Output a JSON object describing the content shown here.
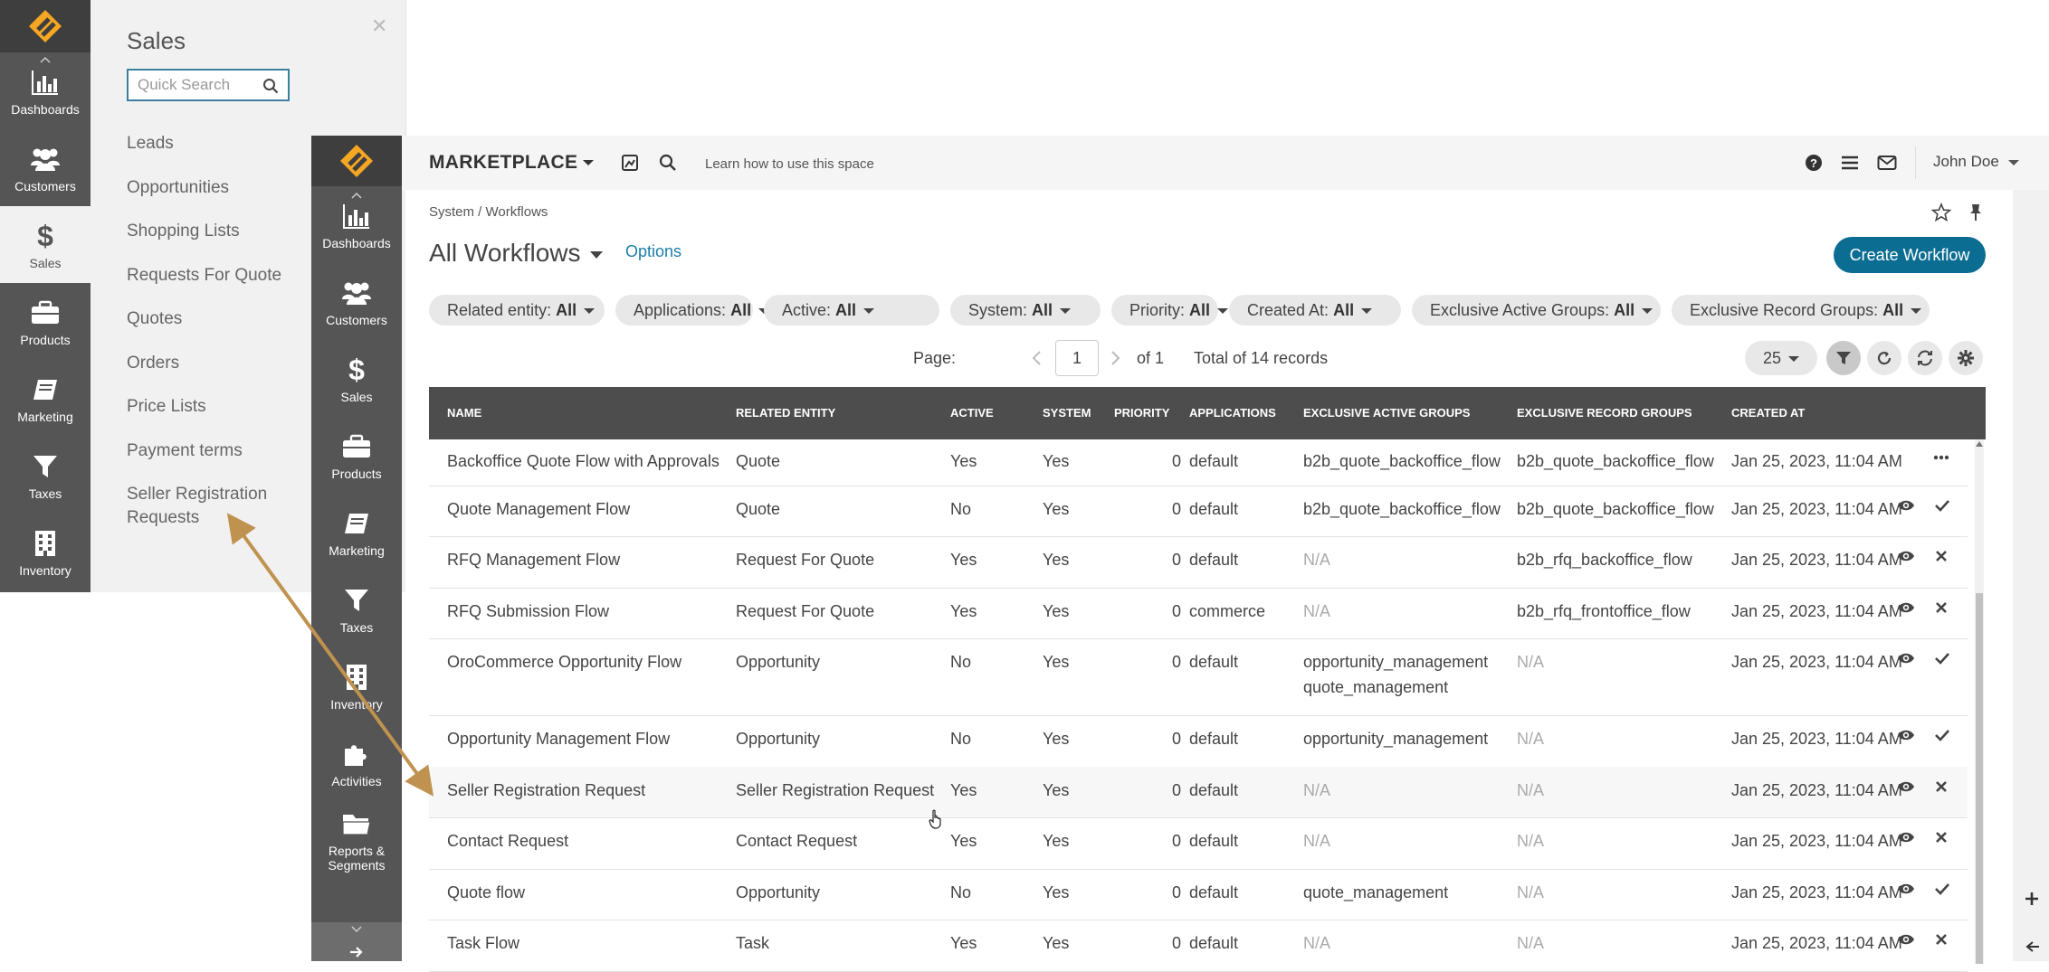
{
  "menu": {
    "section_title": "Sales",
    "search_placeholder": "Quick Search",
    "items": [
      "Leads",
      "Opportunities",
      "Shopping Lists",
      "Requests For Quote",
      "Quotes",
      "Orders",
      "Price Lists",
      "Payment terms",
      "Seller Registration Requests"
    ]
  },
  "outer_sidebar": {
    "items": [
      {
        "label": "Dashboards",
        "icon": "bar-chart-icon"
      },
      {
        "label": "Customers",
        "icon": "users-icon"
      },
      {
        "label": "Sales",
        "icon": "dollar-icon"
      },
      {
        "label": "Products",
        "icon": "briefcase-icon"
      },
      {
        "label": "Marketing",
        "icon": "book-icon"
      },
      {
        "label": "Taxes",
        "icon": "filter-icon"
      },
      {
        "label": "Inventory",
        "icon": "building-icon"
      }
    ]
  },
  "inner_sidebar": {
    "items": [
      {
        "label": "Dashboards",
        "icon": "bar-chart-icon"
      },
      {
        "label": "Customers",
        "icon": "users-icon"
      },
      {
        "label": "Sales",
        "icon": "dollar-icon"
      },
      {
        "label": "Products",
        "icon": "briefcase-icon"
      },
      {
        "label": "Marketing",
        "icon": "book-icon"
      },
      {
        "label": "Taxes",
        "icon": "filter-icon"
      },
      {
        "label": "Inventory",
        "icon": "building-icon"
      },
      {
        "label": "Activities",
        "icon": "puzzle-icon"
      },
      {
        "label": "Reports & Segments",
        "icon": "folder-icon"
      }
    ]
  },
  "topbar": {
    "brand": "MARKETPLACE",
    "learn_link": "Learn how to use this space",
    "user_name": "John Doe"
  },
  "page": {
    "breadcrumb": "System / Workflows",
    "title": "All Workflows",
    "options": "Options",
    "create_button": "Create Workflow"
  },
  "filters": [
    {
      "label": "Related entity:",
      "value": "All"
    },
    {
      "label": "Applications:",
      "value": "All"
    },
    {
      "label": "Active:",
      "value": "All"
    },
    {
      "label": "System:",
      "value": "All"
    },
    {
      "label": "Priority:",
      "value": "All"
    },
    {
      "label": "Created At:",
      "value": "All"
    },
    {
      "label": "Exclusive Active Groups:",
      "value": "All"
    },
    {
      "label": "Exclusive Record Groups:",
      "value": "All"
    }
  ],
  "pager": {
    "page_label": "Page:",
    "current_page": "1",
    "of_label": "of 1",
    "total": "Total of 14 records",
    "page_size": "25"
  },
  "grid": {
    "columns": [
      "NAME",
      "RELATED ENTITY",
      "ACTIVE",
      "SYSTEM",
      "PRIORITY",
      "APPLICATIONS",
      "EXCLUSIVE ACTIVE GROUPS",
      "EXCLUSIVE RECORD GROUPS",
      "CREATED AT"
    ],
    "rows": [
      {
        "name": "Backoffice Quote Flow with Approvals",
        "entity": "Quote",
        "active": "Yes",
        "system": "Yes",
        "priority": "0",
        "applications": "default",
        "active_groups": [
          "b2b_quote_backoffice_flow"
        ],
        "record_groups": "b2b_quote_backoffice_flow",
        "created": "Jan 25, 2023, 11:04 AM",
        "actions": [
          "more"
        ]
      },
      {
        "name": "Quote Management Flow",
        "entity": "Quote",
        "active": "No",
        "system": "Yes",
        "priority": "0",
        "applications": "default",
        "active_groups": [
          "b2b_quote_backoffice_flow"
        ],
        "record_groups": "b2b_quote_backoffice_flow",
        "created": "Jan 25, 2023, 11:04 AM",
        "actions": [
          "view",
          "activate"
        ]
      },
      {
        "name": "RFQ Management Flow",
        "entity": "Request For Quote",
        "active": "Yes",
        "system": "Yes",
        "priority": "0",
        "applications": "default",
        "active_groups": [
          "N/A"
        ],
        "record_groups": "b2b_rfq_backoffice_flow",
        "created": "Jan 25, 2023, 11:04 AM",
        "actions": [
          "view",
          "deactivate"
        ]
      },
      {
        "name": "RFQ Submission Flow",
        "entity": "Request For Quote",
        "active": "Yes",
        "system": "Yes",
        "priority": "0",
        "applications": "commerce",
        "active_groups": [
          "N/A"
        ],
        "record_groups": "b2b_rfq_frontoffice_flow",
        "created": "Jan 25, 2023, 11:04 AM",
        "actions": [
          "view",
          "deactivate"
        ]
      },
      {
        "name": "OroCommerce Opportunity Flow",
        "entity": "Opportunity",
        "active": "No",
        "system": "Yes",
        "priority": "0",
        "applications": "default",
        "active_groups": [
          "opportunity_management",
          "quote_management"
        ],
        "record_groups": "N/A",
        "created": "Jan 25, 2023, 11:04 AM",
        "actions": [
          "view",
          "activate"
        ]
      },
      {
        "name": "Opportunity Management Flow",
        "entity": "Opportunity",
        "active": "No",
        "system": "Yes",
        "priority": "0",
        "applications": "default",
        "active_groups": [
          "opportunity_management"
        ],
        "record_groups": "N/A",
        "created": "Jan 25, 2023, 11:04 AM",
        "actions": [
          "view",
          "activate"
        ]
      },
      {
        "name": "Seller Registration Request",
        "entity": "Seller Registration Request",
        "active": "Yes",
        "system": "Yes",
        "priority": "0",
        "applications": "default",
        "active_groups": [
          "N/A"
        ],
        "record_groups": "N/A",
        "created": "Jan 25, 2023, 11:04 AM",
        "actions": [
          "view",
          "deactivate"
        ]
      },
      {
        "name": "Contact Request",
        "entity": "Contact Request",
        "active": "Yes",
        "system": "Yes",
        "priority": "0",
        "applications": "default",
        "active_groups": [
          "N/A"
        ],
        "record_groups": "N/A",
        "created": "Jan 25, 2023, 11:04 AM",
        "actions": [
          "view",
          "deactivate"
        ]
      },
      {
        "name": "Quote flow",
        "entity": "Opportunity",
        "active": "No",
        "system": "Yes",
        "priority": "0",
        "applications": "default",
        "active_groups": [
          "quote_management"
        ],
        "record_groups": "N/A",
        "created": "Jan 25, 2023, 11:04 AM",
        "actions": [
          "view",
          "activate"
        ]
      },
      {
        "name": "Task Flow",
        "entity": "Task",
        "active": "Yes",
        "system": "Yes",
        "priority": "0",
        "applications": "default",
        "active_groups": [
          "N/A"
        ],
        "record_groups": "N/A",
        "created": "Jan 25, 2023, 11:04 AM",
        "actions": [
          "view",
          "deactivate"
        ]
      }
    ]
  },
  "colors": {
    "sidebar": "#555555",
    "accent": "#0c6d92",
    "annotation_arrow": "#c0924f"
  }
}
